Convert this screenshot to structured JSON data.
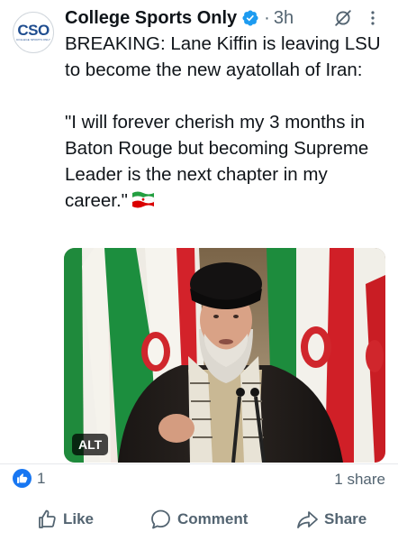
{
  "author": {
    "name": "College Sports Only",
    "avatar_logo": "CSO",
    "avatar_subtext": "COLLEGE SPORTS ONLY",
    "verified_icon": "verified-badge-icon",
    "time_separator": "·",
    "time": "3h"
  },
  "post": {
    "headline": "BREAKING: Lane Kiffin is leaving LSU to become the new ayatollah of Iran:",
    "quote": "\"I will forever cherish my 3 months in Baton Rouge but becoming Supreme Leader is the next chapter in my career.\"",
    "flag_icon": "iran-flag-icon"
  },
  "media": {
    "alt_badge": "ALT"
  },
  "stats": {
    "like_count": "1",
    "share_count": "1 share"
  },
  "actions": {
    "like": "Like",
    "comment": "Comment",
    "share": "Share"
  },
  "colors": {
    "text_primary": "#0f1419",
    "text_secondary": "#536471",
    "verified_blue": "#1d9bf0",
    "facebook_blue": "#1877f2",
    "avatar_logo": "#1f4d8f"
  }
}
